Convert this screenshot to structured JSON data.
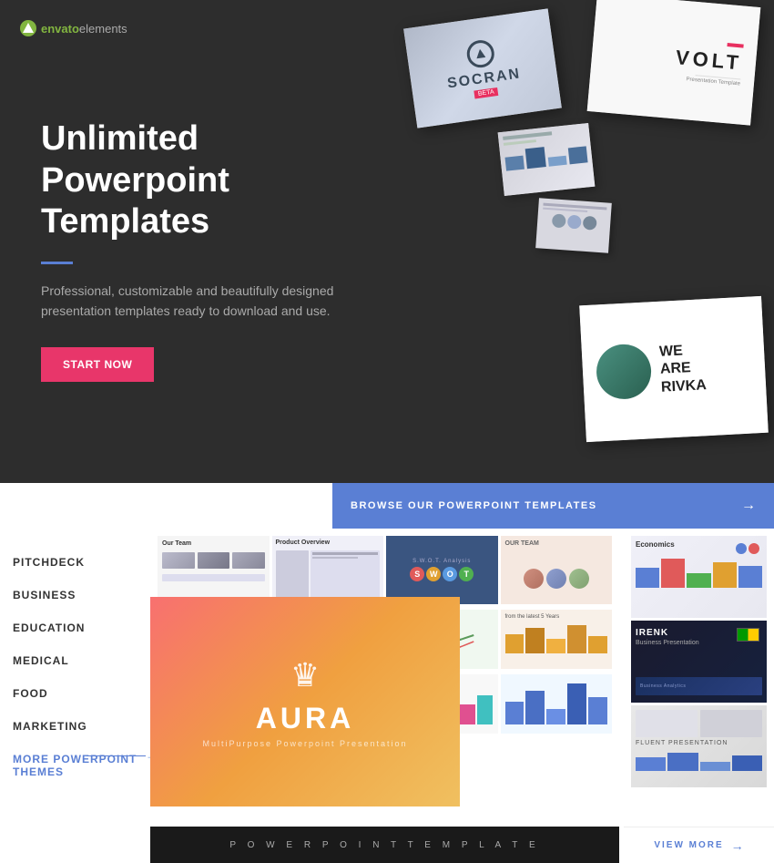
{
  "logo": {
    "brand": "envato",
    "product": "elements"
  },
  "hero": {
    "title": "Unlimited Powerpoint Templates",
    "subtitle": "Professional, customizable and beautifully designed presentation templates ready to download and use.",
    "cta_label": "START NOW",
    "mockups": {
      "socran": "SOCRAN",
      "volt": "VOLT",
      "rivka": "WE ARE RIVKA"
    }
  },
  "browse": {
    "banner_text": "BROWSE OUR POWERPOINT TEMPLATES"
  },
  "nav": {
    "items": [
      {
        "label": "PITCHDECK",
        "special": false
      },
      {
        "label": "BUSINESS",
        "special": false
      },
      {
        "label": "EDUCATION",
        "special": false
      },
      {
        "label": "MEDICAL",
        "special": false
      },
      {
        "label": "FOOD",
        "special": false
      },
      {
        "label": "MARKETING",
        "special": false
      },
      {
        "label": "MORE POWERPOINT THEMES",
        "special": true
      }
    ]
  },
  "aura": {
    "title": "AURA",
    "subtitle": "MultiPurpose Powerpoint Presentation"
  },
  "bottom_bar": {
    "text": "P O W E R P O I N T   T E M P L A T E"
  },
  "right_thumbs": [
    {
      "label": "Economics",
      "type": "economics"
    },
    {
      "label": "IRENK",
      "type": "irenk"
    },
    {
      "label": "FLUENT PRESENTATION",
      "type": "fluent"
    }
  ],
  "view_more": {
    "label": "VIEW MORE"
  }
}
